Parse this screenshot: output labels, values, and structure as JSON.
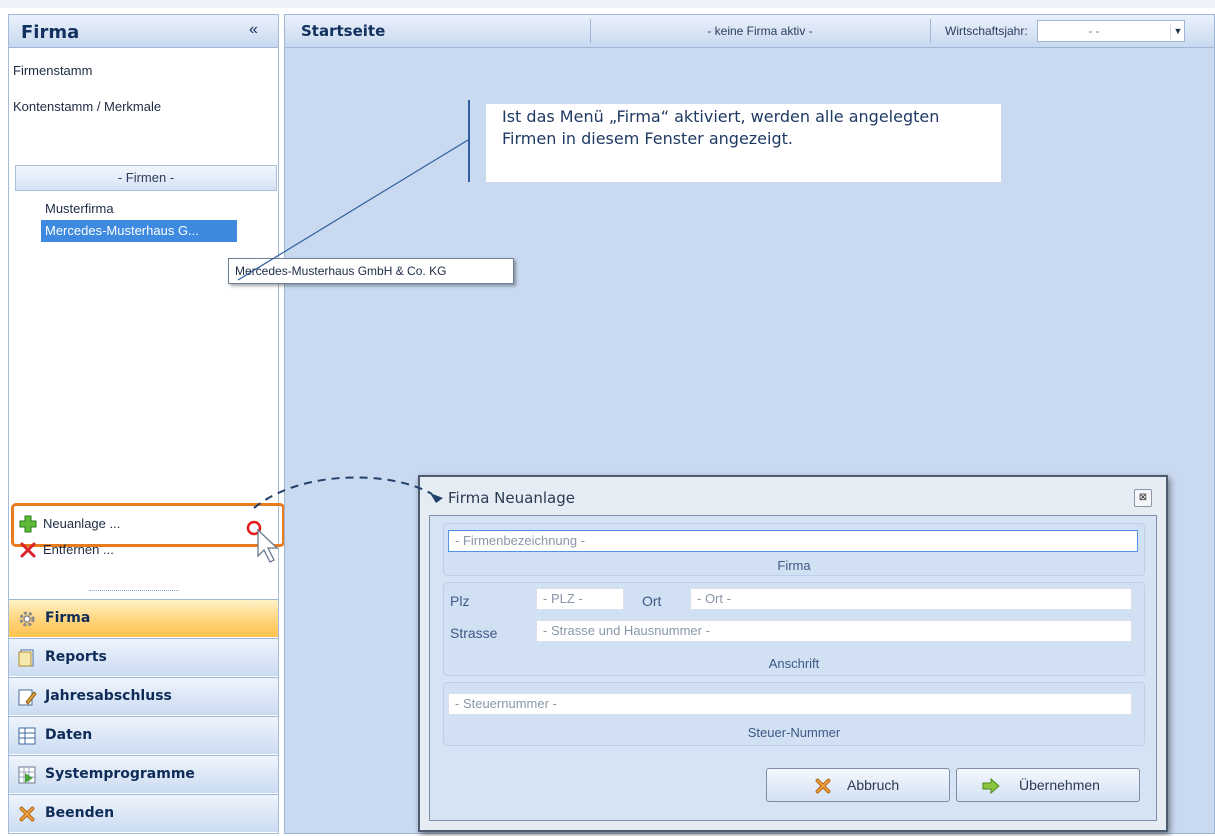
{
  "left_panel": {
    "title": "Firma",
    "collapse_glyph": "«",
    "links": [
      "Firmenstamm",
      "Kontenstamm / Merkmale"
    ],
    "section_header": "- Firmen -",
    "firms": [
      "Musterfirma",
      "Mercedes-Musterhaus G..."
    ],
    "tooltip": "Mercedes-Musterhaus GmbH & Co. KG",
    "actions": [
      {
        "label": "Neuanlage ...",
        "icon": "green-plus-icon"
      },
      {
        "label": "Entfernen ...",
        "icon": "red-x-icon"
      }
    ],
    "nav": [
      {
        "label": "Firma",
        "icon": "gear-icon",
        "active": true
      },
      {
        "label": "Reports",
        "icon": "document-icon",
        "active": false
      },
      {
        "label": "Jahresabschluss",
        "icon": "edit-document-icon",
        "active": false
      },
      {
        "label": "Daten",
        "icon": "table-icon",
        "active": false
      },
      {
        "label": "Systemprogramme",
        "icon": "grid-arrow-icon",
        "active": false
      },
      {
        "label": "Beenden",
        "icon": "exit-icon",
        "active": false
      }
    ]
  },
  "main": {
    "title": "Startseite",
    "status": "- keine Firma aktiv -",
    "fiscal_year_label": "Wirtschaftsjahr:",
    "fiscal_year_value": "- -"
  },
  "annotation": "Ist das Menü „Firma“ aktiviert, werden alle angelegten Firmen in diesem Fenster angezeigt.",
  "dialog": {
    "title": "Firma Neuanlage",
    "close_glyph": "⊠",
    "firma_group": {
      "name_placeholder": "- Firmenbezeichnung -",
      "caption": "Firma"
    },
    "address_group": {
      "plz_label": "Plz",
      "plz_placeholder": "- PLZ -",
      "ort_label": "Ort",
      "ort_placeholder": "- Ort -",
      "street_label": "Strasse",
      "street_placeholder": "- Strasse und Hausnummer -",
      "caption": "Anschrift"
    },
    "tax_group": {
      "tax_placeholder": "- Steuernummer -",
      "caption": "Steuer-Nummer"
    },
    "cancel_label": "Abbruch",
    "apply_label": "Übernehmen"
  },
  "colors": {
    "accent_orange": "#e87b1e",
    "selection_blue": "#3d8ae0",
    "panel_blue": "#c9d9ef"
  }
}
